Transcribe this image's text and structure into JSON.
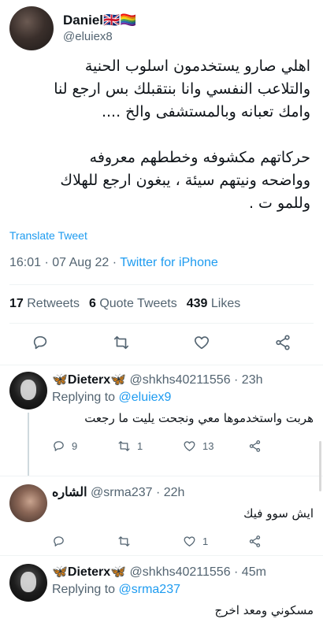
{
  "tweet": {
    "author_name": "Daniel🇬🇧🏳️‍🌈",
    "author_handle": "@eluiex8",
    "text_p1": "اهلي صارو يستخدمون اسلوب الحنية\nوالتلاعب النفسي وانا بنتقبلك بس ارجع لنا\nوامك تعبانه وبالمستشفى والخ ....",
    "text_p2": "حركاتهم مكشوفه وخططهم معروفه\nوواضحه ونيتهم سيئة ، يبغون ارجع للهلاك\nوللمو ت .",
    "translate_label": "Translate Tweet",
    "time": "16:01 · 07 Aug 22 · ",
    "source": "Twitter for iPhone",
    "retweets_count": "17",
    "retweets_label": "Retweets",
    "quotes_count": "6",
    "quotes_label": "Quote Tweets",
    "likes_count": "439",
    "likes_label": "Likes"
  },
  "replies": [
    {
      "name": "Dieterx",
      "name_prefix_emoji": "🦋",
      "name_suffix_emoji": "🦋",
      "handle_time": "@shkhs40211556 · 23h",
      "replying_label": "Replying to ",
      "replying_to": "@eluiex9",
      "text": "هربت واستخدموها معي ونجحت يليت ما رجعت",
      "reply_count": "9",
      "retweet_count": "1",
      "like_count": "13"
    },
    {
      "name": "الشاره",
      "handle_time": "@srma237 · 22h",
      "text": "ايش سوو فيك",
      "like_count": "1"
    },
    {
      "name": "Dieterx",
      "name_prefix_emoji": "🦋",
      "name_suffix_emoji": "🦋",
      "handle_time": "@shkhs40211556 · 45m",
      "replying_label": "Replying to ",
      "replying_to": "@srma237",
      "text": "مسكوني  ومعد اخرج"
    }
  ],
  "icons": [
    "reply-icon",
    "retweet-icon",
    "like-icon",
    "share-icon"
  ],
  "colors": {
    "accent": "#1d9bf0",
    "secondary_text": "#536471",
    "text": "#0f1419"
  }
}
